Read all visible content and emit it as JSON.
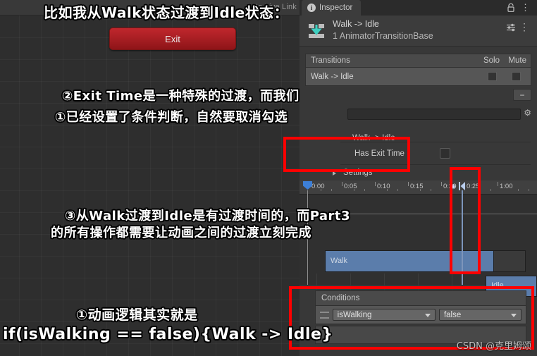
{
  "animator": {
    "auto_live_link": "Auto Live Link",
    "exit_node_label": "Exit"
  },
  "annotations": {
    "title": "比如我从Walk状态过渡到Idle状态：",
    "note2": "②Exit Time是一种特殊的过渡，而我们",
    "note1a": "①已经设置了条件判断，自然要取消勾选",
    "note3a": "③从Walk过渡到Idle是有过渡时间的，而Part3",
    "note3b": "的所有操作都需要让动画之间的过渡立刻完成",
    "note4a": "①动画逻辑其实就是",
    "note4b": "if(isWalking == false){Walk -> Idle}"
  },
  "inspector": {
    "tab_label": "Inspector",
    "icons": {
      "info": "i",
      "lock": "lock-icon",
      "tab_menu": "⋮",
      "header_menu": "⋮",
      "preset": "preset-icon",
      "gear": "⚙"
    },
    "header": {
      "title": "Walk -> Idle",
      "subtitle": "1 AnimatorTransitionBase"
    },
    "transitions": {
      "header_label": "Transitions",
      "solo_label": "Solo",
      "mute_label": "Mute",
      "rows": [
        {
          "label": "Walk -> Idle",
          "solo": false,
          "mute": false
        }
      ],
      "minus_label": "−"
    },
    "name_field": {
      "value": "",
      "placeholder": ""
    },
    "transition_detail": {
      "sub_title": "Walk -> Idle",
      "has_exit_time_label": "Has Exit Time",
      "has_exit_time_checked": false,
      "settings_label": "Settings"
    },
    "timeline": {
      "ticks": [
        "0:00",
        "0:05",
        "0:10",
        "0:15",
        "0:20",
        "0:25",
        "1:00"
      ],
      "clips": [
        {
          "name": "Walk"
        },
        {
          "name": "Idle"
        }
      ]
    },
    "conditions": {
      "header_label": "Conditions",
      "rows": [
        {
          "parameter": "isWalking",
          "value": "false"
        }
      ]
    }
  },
  "watermark": "CSDN @克里姆颂",
  "colors": {
    "accent_blue": "#5b7dab",
    "highlight_red": "#ff0000",
    "exit_node_red": "#aa1f24",
    "panel_bg": "#383838"
  }
}
